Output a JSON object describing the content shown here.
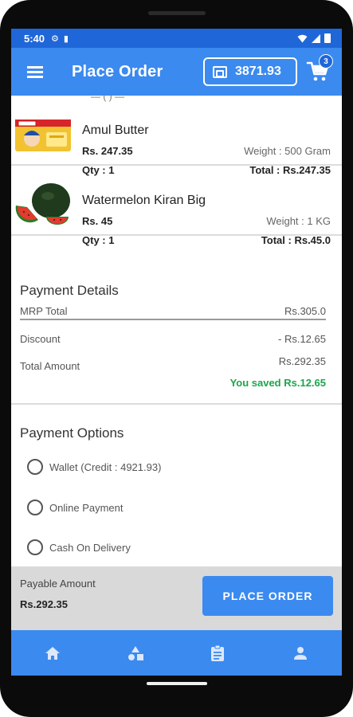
{
  "status_bar": {
    "time": "5:40"
  },
  "header": {
    "title": "Place Order",
    "wallet_balance": "3871.93",
    "cart_count": "3"
  },
  "order_items": [
    {
      "name": "Amul Butter",
      "price": "Rs. 247.35",
      "weight": "Weight : 500 Gram",
      "qty": "Qty : 1",
      "total": "Total : Rs.247.35",
      "image_icon": "butter-pack-image"
    },
    {
      "name": "Watermelon Kiran Big",
      "price": "Rs. 45",
      "weight": "Weight : 1 KG",
      "qty": "Qty : 1",
      "total": "Total : Rs.45.0",
      "image_icon": "watermelon-image"
    }
  ],
  "payment_details": {
    "title": "Payment Details",
    "mrp_label": "MRP Total",
    "mrp_value": "Rs.305.0",
    "discount_label": "Discount",
    "discount_value": "- Rs.12.65",
    "total_label": "Total Amount",
    "total_value": "Rs.292.35",
    "saved_text": "You saved Rs.12.65"
  },
  "payment_options": {
    "title": "Payment Options",
    "options": [
      "Wallet (Credit : 4921.93)",
      "Online Payment",
      "Cash On Delivery"
    ]
  },
  "payable": {
    "label": "Payable Amount",
    "value": "Rs.292.35",
    "button": "PLACE ORDER"
  },
  "bottom_nav": [
    "home-icon",
    "categories-icon",
    "orders-icon",
    "profile-icon"
  ],
  "colors": {
    "primary": "#3b8aef",
    "status_bar": "#1f66d8",
    "saved": "#1aa64a",
    "payable_bg": "#d9d9d9"
  }
}
